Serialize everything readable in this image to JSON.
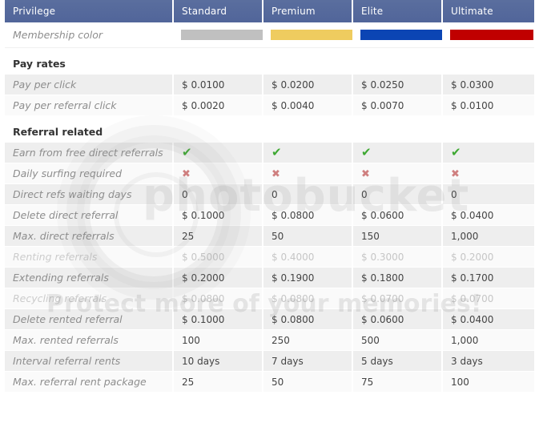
{
  "table": {
    "columns": [
      "Privilege",
      "Standard",
      "Premium",
      "Elite",
      "Ultimate"
    ],
    "membership_color_row": {
      "label": "Membership color",
      "swatches": [
        {
          "plan": "Standard",
          "color": "#c0c0c0"
        },
        {
          "plan": "Premium",
          "color": "#efcc5f"
        },
        {
          "plan": "Elite",
          "color": "#0b45b4"
        },
        {
          "plan": "Ultimate",
          "color": "#c00000"
        }
      ]
    },
    "sections": [
      {
        "title": "Pay rates",
        "rows": [
          {
            "label": "Pay per click",
            "values": [
              "$ 0.0100",
              "$ 0.0200",
              "$ 0.0250",
              "$ 0.0300"
            ],
            "dim": false
          },
          {
            "label": "Pay per referral click",
            "values": [
              "$ 0.0020",
              "$ 0.0040",
              "$ 0.0070",
              "$ 0.0100"
            ],
            "dim": false
          }
        ]
      },
      {
        "title": "Referral related",
        "rows": [
          {
            "label": "Earn from free direct referrals",
            "values": [
              "check-icon",
              "check-icon",
              "check-icon",
              "check-icon"
            ],
            "type": "icon",
            "dim": false
          },
          {
            "label": "Daily surfing required",
            "values": [
              "cross-icon",
              "cross-icon",
              "cross-icon",
              "cross-icon"
            ],
            "type": "icon",
            "dim": false
          },
          {
            "label": "Direct refs waiting days",
            "values": [
              "0",
              "0",
              "0",
              "0"
            ],
            "dim": false
          },
          {
            "label": "Delete direct referral",
            "values": [
              "$ 0.1000",
              "$ 0.0800",
              "$ 0.0600",
              "$ 0.0400"
            ],
            "dim": false
          },
          {
            "label": "Max. direct referrals",
            "values": [
              "25",
              "50",
              "150",
              "1,000"
            ],
            "dim": false
          },
          {
            "label": "Renting referrals",
            "values": [
              "$ 0.5000",
              "$ 0.4000",
              "$ 0.3000",
              "$ 0.2000"
            ],
            "dim": true
          },
          {
            "label": "Extending referrals",
            "values": [
              "$ 0.2000",
              "$ 0.1900",
              "$ 0.1800",
              "$ 0.1700"
            ],
            "dim": false
          },
          {
            "label": "Recycling referrals",
            "values": [
              "$ 0.0800",
              "$ 0.0800",
              "$ 0.0700",
              "$ 0.0700"
            ],
            "dim": true
          },
          {
            "label": "Delete rented referral",
            "values": [
              "$ 0.1000",
              "$ 0.0800",
              "$ 0.0600",
              "$ 0.0400"
            ],
            "dim": false
          },
          {
            "label": "Max. rented referrals",
            "values": [
              "100",
              "250",
              "500",
              "1,000"
            ],
            "dim": false
          },
          {
            "label": "Interval referral rents",
            "values": [
              "10 days",
              "7 days",
              "5 days",
              "3 days"
            ],
            "dim": false
          },
          {
            "label": "Max. referral rent package",
            "values": [
              "25",
              "50",
              "75",
              "100"
            ],
            "dim": false
          }
        ]
      }
    ]
  },
  "watermark": {
    "brand": "photobucket",
    "tagline": "Protect more of your memories!"
  },
  "colors": {
    "header_bg": "#55699c",
    "row_alt_bg": "#eeeeee",
    "row_plain_bg": "#fafafa",
    "check": "#3ea832",
    "cross": "#cf7f7f"
  }
}
